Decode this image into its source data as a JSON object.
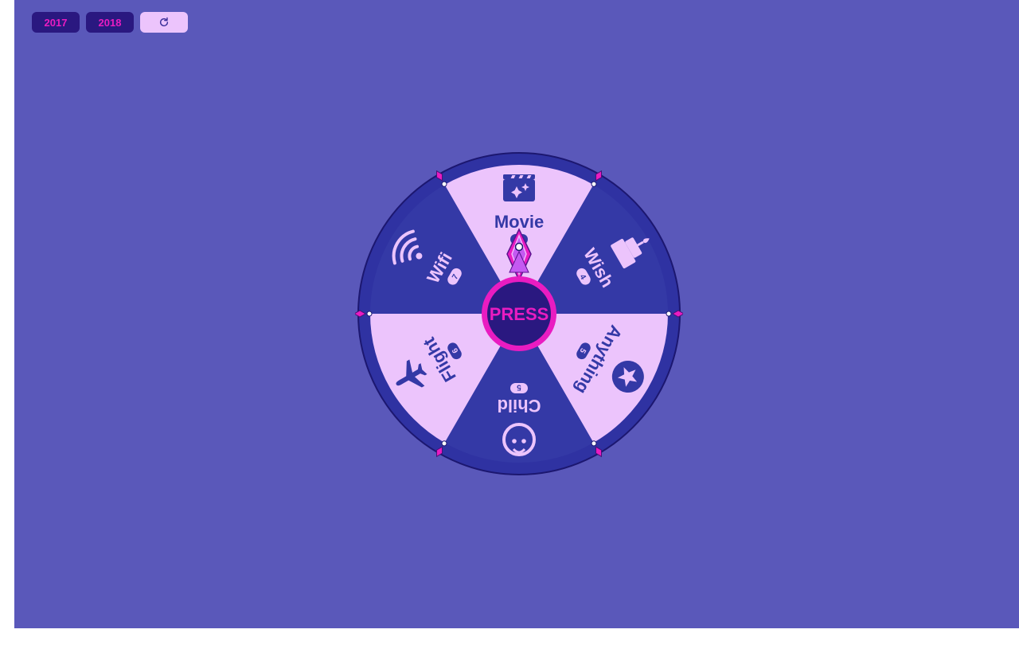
{
  "toolbar": {
    "buttons": [
      {
        "label": "2017"
      },
      {
        "label": "2018"
      }
    ],
    "reset_icon": "refresh-icon"
  },
  "wheel": {
    "center_label": "PRESS",
    "segments": [
      {
        "label": "Movie",
        "count": "3",
        "icon": "movie-clapper-icon",
        "color": "#ecc4fc",
        "text_color": "#3439a6"
      },
      {
        "label": "Wish",
        "count": "4",
        "icon": "birthday-cake-icon",
        "color": "#3439a6",
        "text_color": "#ecc4fc"
      },
      {
        "label": "Anything",
        "count": "5",
        "icon": "star-icon",
        "color": "#ecc4fc",
        "text_color": "#3439a6"
      },
      {
        "label": "Child",
        "count": "5",
        "icon": "baby-face-icon",
        "color": "#3439a6",
        "text_color": "#ecc4fc"
      },
      {
        "label": "Flight",
        "count": "6",
        "icon": "airplane-icon",
        "color": "#ecc4fc",
        "text_color": "#3439a6"
      },
      {
        "label": "Wifi",
        "count": "7",
        "icon": "wifi-icon",
        "color": "#3439a6",
        "text_color": "#ecc4fc"
      }
    ],
    "colors": {
      "rim": "#2f32a2",
      "rim_stroke": "#1c1770",
      "center_fill": "#2a1880",
      "accent": "#e91cc1",
      "pointer_inner": "#c45af2"
    }
  }
}
